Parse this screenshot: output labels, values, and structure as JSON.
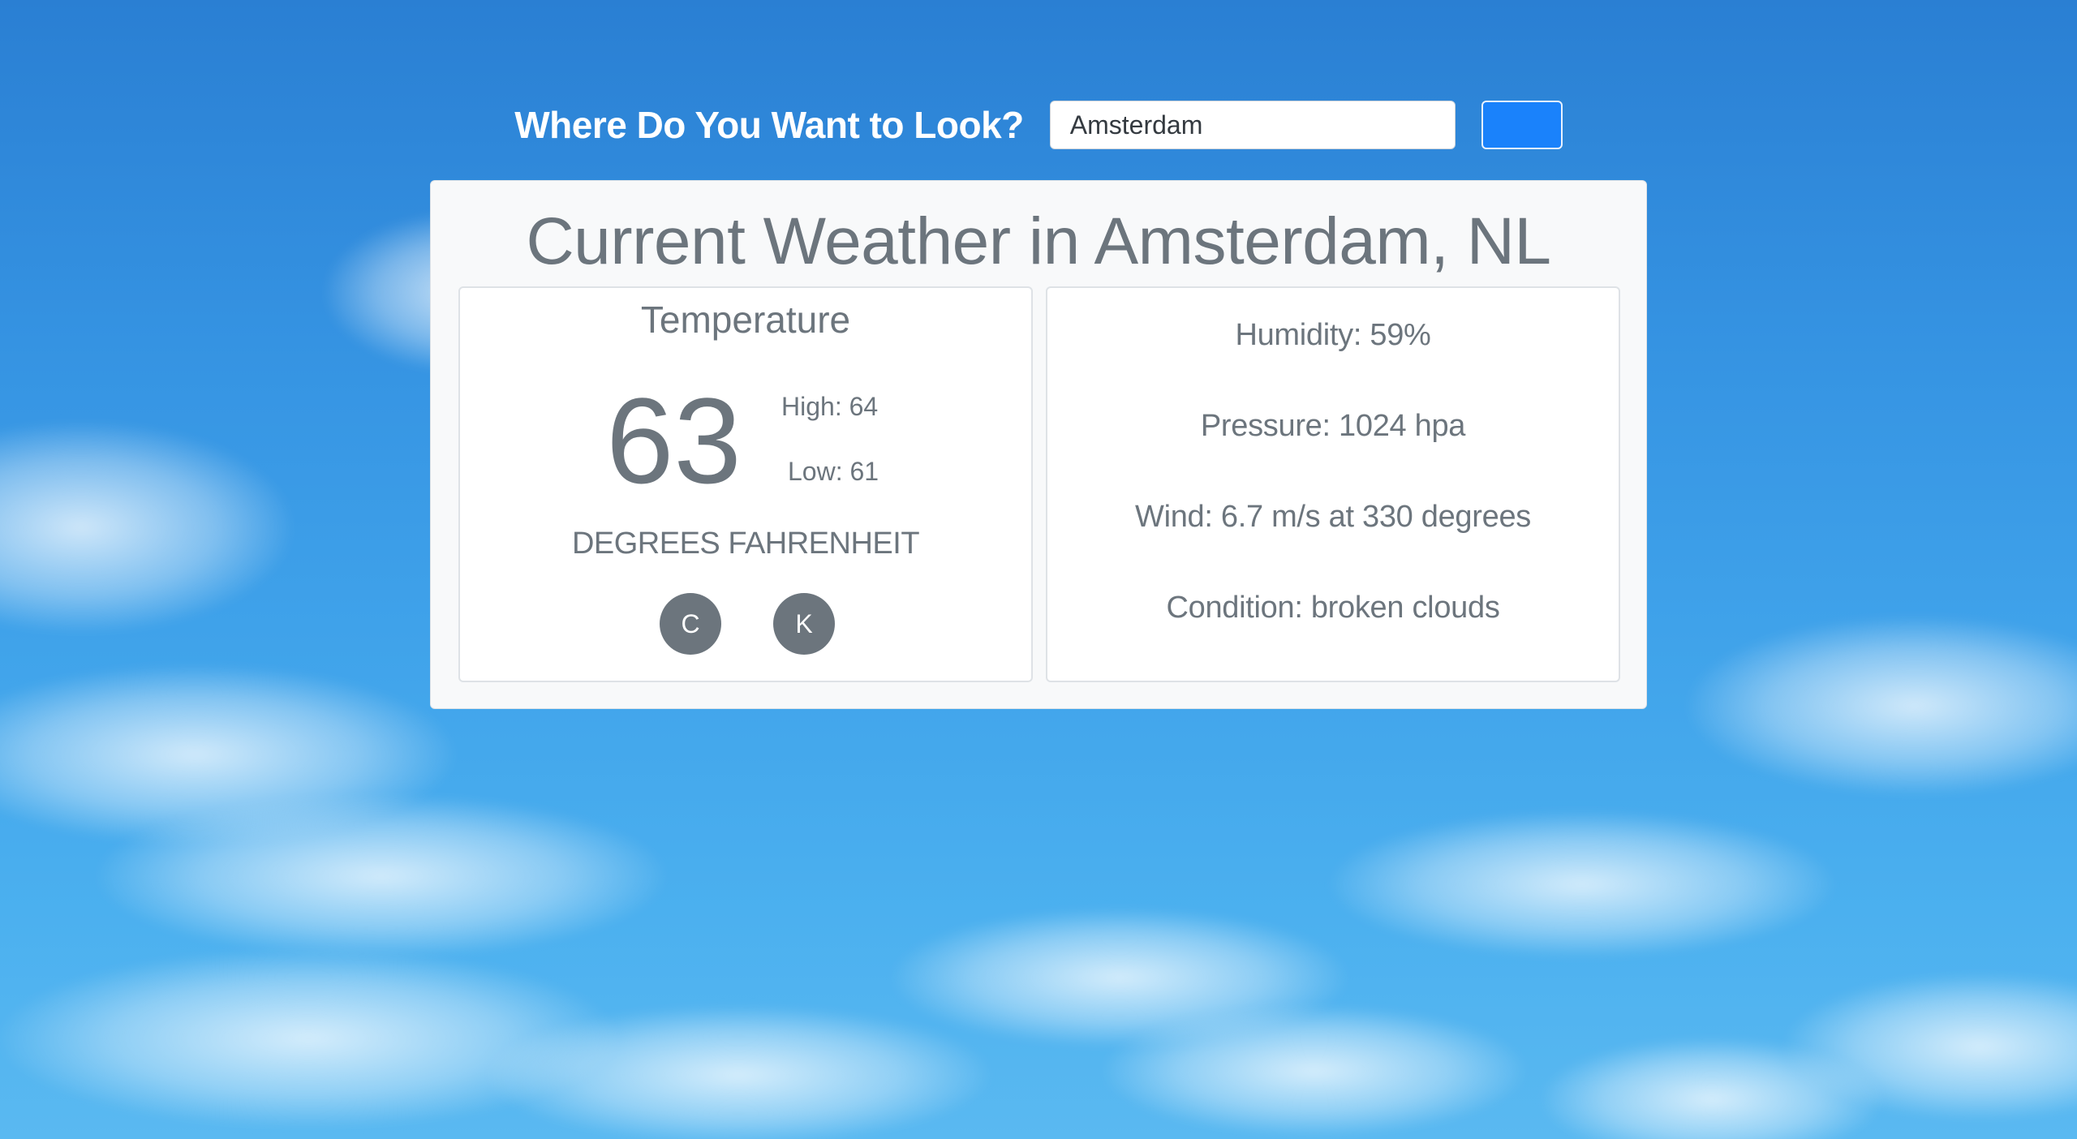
{
  "search": {
    "label": "Where Do You Want to Look?",
    "value": "Amsterdam",
    "button_label": ""
  },
  "weather": {
    "title": "Current Weather in Amsterdam, NL",
    "temperature": {
      "heading": "Temperature",
      "value": "63",
      "high": "High: 64",
      "low": "Low: 61",
      "unit_label": "DEGREES FAHRENHEIT",
      "unit_buttons": [
        "C",
        "K"
      ]
    },
    "stats": [
      "Humidity: 59%",
      "Pressure: 1024 hpa",
      "Wind: 6.7 m/s at 330 degrees",
      "Condition: broken clouds"
    ]
  },
  "colors": {
    "accent_button": "#1a82fb",
    "text_muted": "#6c757d",
    "card_background": "#f8f9fa",
    "sky": "#3593e2"
  }
}
